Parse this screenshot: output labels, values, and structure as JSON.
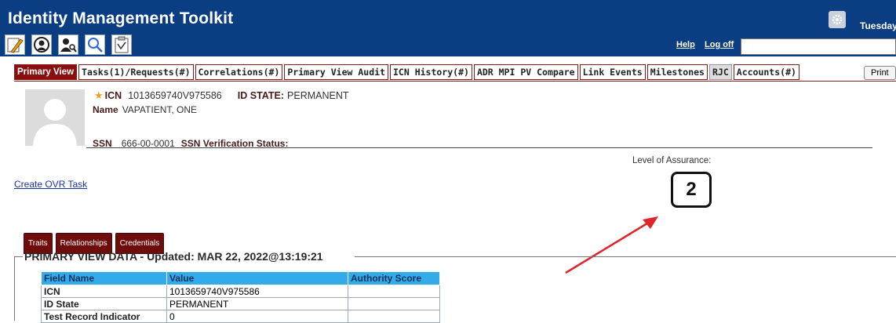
{
  "header": {
    "title": "Identity Management Toolkit",
    "date_text": "Tuesday",
    "help_label": "Help",
    "logoff_label": "Log off",
    "toolbar_icons": [
      "edit-icon",
      "person-search-icon",
      "person-lookup-icon",
      "magnifier-icon",
      "clipboard-icon"
    ],
    "bg_color": "#0a3d82"
  },
  "tabs": [
    {
      "label": "Primary View",
      "active": true
    },
    {
      "label": "Tasks(1)/Requests(#)"
    },
    {
      "label": "Correlations(#)"
    },
    {
      "label": "Primary View Audit"
    },
    {
      "label": "ICN History(#)"
    },
    {
      "label": "ADR MPI PV Compare"
    },
    {
      "label": "Link Events"
    },
    {
      "label": "Milestones"
    },
    {
      "label": "RJC"
    },
    {
      "label": "Accounts(#)"
    }
  ],
  "print_label": "Print",
  "person": {
    "icn_label": "ICN",
    "icn_value": "1013659740V975586",
    "id_state_label": "ID STATE:",
    "id_state_value": "PERMANENT",
    "name_label": "Name",
    "name_value": "VAPATIENT, ONE",
    "ssn_label": "SSN",
    "ssn_value": "666-00-0001",
    "ssn_verification_label": "SSN Verification Status:"
  },
  "level_of_assurance": {
    "label": "Level of Assurance:",
    "value": "2"
  },
  "create_ovr_label": "Create OVR Task",
  "subtabs": [
    "Traits",
    "Relationships",
    "Credentials"
  ],
  "primary_view": {
    "legend": "PRIMARY VIEW DATA - Updated: MAR 22, 2022@13:19:21",
    "columns": [
      "Field Name",
      "Value",
      "Authority Score"
    ],
    "rows": [
      [
        "ICN",
        "1013659740V975586",
        ""
      ],
      [
        "ID State",
        "PERMANENT",
        ""
      ],
      [
        "Test Record Indicator",
        "0",
        ""
      ]
    ]
  },
  "colors": {
    "tab_active": "#8a1010",
    "table_header": "#33aaea",
    "annotation_arrow": "#e0262b"
  }
}
